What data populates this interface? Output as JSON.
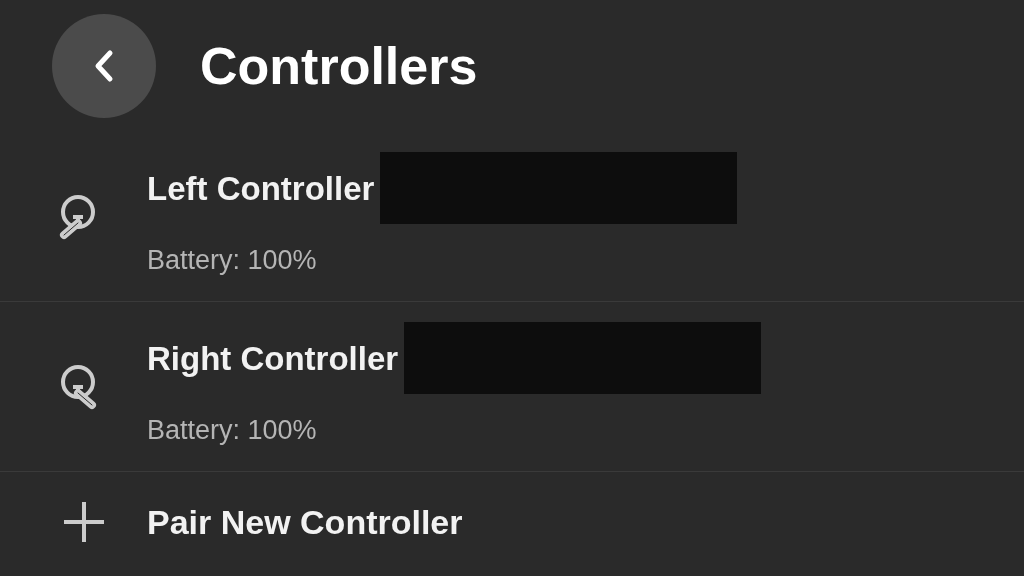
{
  "header": {
    "title": "Controllers"
  },
  "controllers": [
    {
      "kind": "left",
      "name": "Left Controller",
      "battery": "Battery: 100%",
      "redacted": true
    },
    {
      "kind": "right",
      "name": "Right Controller",
      "battery": "Battery: 100%",
      "redacted": true
    }
  ],
  "action": {
    "label": "Pair New Controller"
  }
}
